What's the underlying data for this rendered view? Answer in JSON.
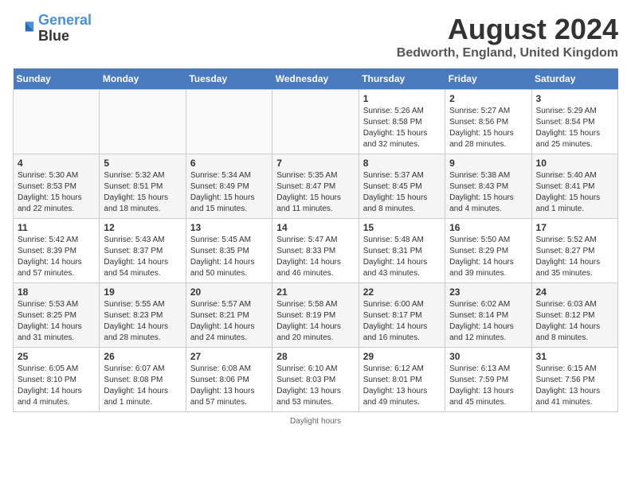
{
  "header": {
    "logo_line1": "General",
    "logo_line2": "Blue",
    "main_title": "August 2024",
    "subtitle": "Bedworth, England, United Kingdom"
  },
  "days_of_week": [
    "Sunday",
    "Monday",
    "Tuesday",
    "Wednesday",
    "Thursday",
    "Friday",
    "Saturday"
  ],
  "weeks": [
    [
      {
        "day": "",
        "sunrise": "",
        "sunset": "",
        "daylight": ""
      },
      {
        "day": "",
        "sunrise": "",
        "sunset": "",
        "daylight": ""
      },
      {
        "day": "",
        "sunrise": "",
        "sunset": "",
        "daylight": ""
      },
      {
        "day": "",
        "sunrise": "",
        "sunset": "",
        "daylight": ""
      },
      {
        "day": "1",
        "sunrise": "5:26 AM",
        "sunset": "8:58 PM",
        "daylight": "15 hours and 32 minutes."
      },
      {
        "day": "2",
        "sunrise": "5:27 AM",
        "sunset": "8:56 PM",
        "daylight": "15 hours and 28 minutes."
      },
      {
        "day": "3",
        "sunrise": "5:29 AM",
        "sunset": "8:54 PM",
        "daylight": "15 hours and 25 minutes."
      }
    ],
    [
      {
        "day": "4",
        "sunrise": "5:30 AM",
        "sunset": "8:53 PM",
        "daylight": "15 hours and 22 minutes."
      },
      {
        "day": "5",
        "sunrise": "5:32 AM",
        "sunset": "8:51 PM",
        "daylight": "15 hours and 18 minutes."
      },
      {
        "day": "6",
        "sunrise": "5:34 AM",
        "sunset": "8:49 PM",
        "daylight": "15 hours and 15 minutes."
      },
      {
        "day": "7",
        "sunrise": "5:35 AM",
        "sunset": "8:47 PM",
        "daylight": "15 hours and 11 minutes."
      },
      {
        "day": "8",
        "sunrise": "5:37 AM",
        "sunset": "8:45 PM",
        "daylight": "15 hours and 8 minutes."
      },
      {
        "day": "9",
        "sunrise": "5:38 AM",
        "sunset": "8:43 PM",
        "daylight": "15 hours and 4 minutes."
      },
      {
        "day": "10",
        "sunrise": "5:40 AM",
        "sunset": "8:41 PM",
        "daylight": "15 hours and 1 minute."
      }
    ],
    [
      {
        "day": "11",
        "sunrise": "5:42 AM",
        "sunset": "8:39 PM",
        "daylight": "14 hours and 57 minutes."
      },
      {
        "day": "12",
        "sunrise": "5:43 AM",
        "sunset": "8:37 PM",
        "daylight": "14 hours and 54 minutes."
      },
      {
        "day": "13",
        "sunrise": "5:45 AM",
        "sunset": "8:35 PM",
        "daylight": "14 hours and 50 minutes."
      },
      {
        "day": "14",
        "sunrise": "5:47 AM",
        "sunset": "8:33 PM",
        "daylight": "14 hours and 46 minutes."
      },
      {
        "day": "15",
        "sunrise": "5:48 AM",
        "sunset": "8:31 PM",
        "daylight": "14 hours and 43 minutes."
      },
      {
        "day": "16",
        "sunrise": "5:50 AM",
        "sunset": "8:29 PM",
        "daylight": "14 hours and 39 minutes."
      },
      {
        "day": "17",
        "sunrise": "5:52 AM",
        "sunset": "8:27 PM",
        "daylight": "14 hours and 35 minutes."
      }
    ],
    [
      {
        "day": "18",
        "sunrise": "5:53 AM",
        "sunset": "8:25 PM",
        "daylight": "14 hours and 31 minutes."
      },
      {
        "day": "19",
        "sunrise": "5:55 AM",
        "sunset": "8:23 PM",
        "daylight": "14 hours and 28 minutes."
      },
      {
        "day": "20",
        "sunrise": "5:57 AM",
        "sunset": "8:21 PM",
        "daylight": "14 hours and 24 minutes."
      },
      {
        "day": "21",
        "sunrise": "5:58 AM",
        "sunset": "8:19 PM",
        "daylight": "14 hours and 20 minutes."
      },
      {
        "day": "22",
        "sunrise": "6:00 AM",
        "sunset": "8:17 PM",
        "daylight": "14 hours and 16 minutes."
      },
      {
        "day": "23",
        "sunrise": "6:02 AM",
        "sunset": "8:14 PM",
        "daylight": "14 hours and 12 minutes."
      },
      {
        "day": "24",
        "sunrise": "6:03 AM",
        "sunset": "8:12 PM",
        "daylight": "14 hours and 8 minutes."
      }
    ],
    [
      {
        "day": "25",
        "sunrise": "6:05 AM",
        "sunset": "8:10 PM",
        "daylight": "14 hours and 4 minutes."
      },
      {
        "day": "26",
        "sunrise": "6:07 AM",
        "sunset": "8:08 PM",
        "daylight": "14 hours and 1 minute."
      },
      {
        "day": "27",
        "sunrise": "6:08 AM",
        "sunset": "8:06 PM",
        "daylight": "13 hours and 57 minutes."
      },
      {
        "day": "28",
        "sunrise": "6:10 AM",
        "sunset": "8:03 PM",
        "daylight": "13 hours and 53 minutes."
      },
      {
        "day": "29",
        "sunrise": "6:12 AM",
        "sunset": "8:01 PM",
        "daylight": "13 hours and 49 minutes."
      },
      {
        "day": "30",
        "sunrise": "6:13 AM",
        "sunset": "7:59 PM",
        "daylight": "13 hours and 45 minutes."
      },
      {
        "day": "31",
        "sunrise": "6:15 AM",
        "sunset": "7:56 PM",
        "daylight": "13 hours and 41 minutes."
      }
    ]
  ],
  "footer": {
    "note": "Daylight hours"
  }
}
